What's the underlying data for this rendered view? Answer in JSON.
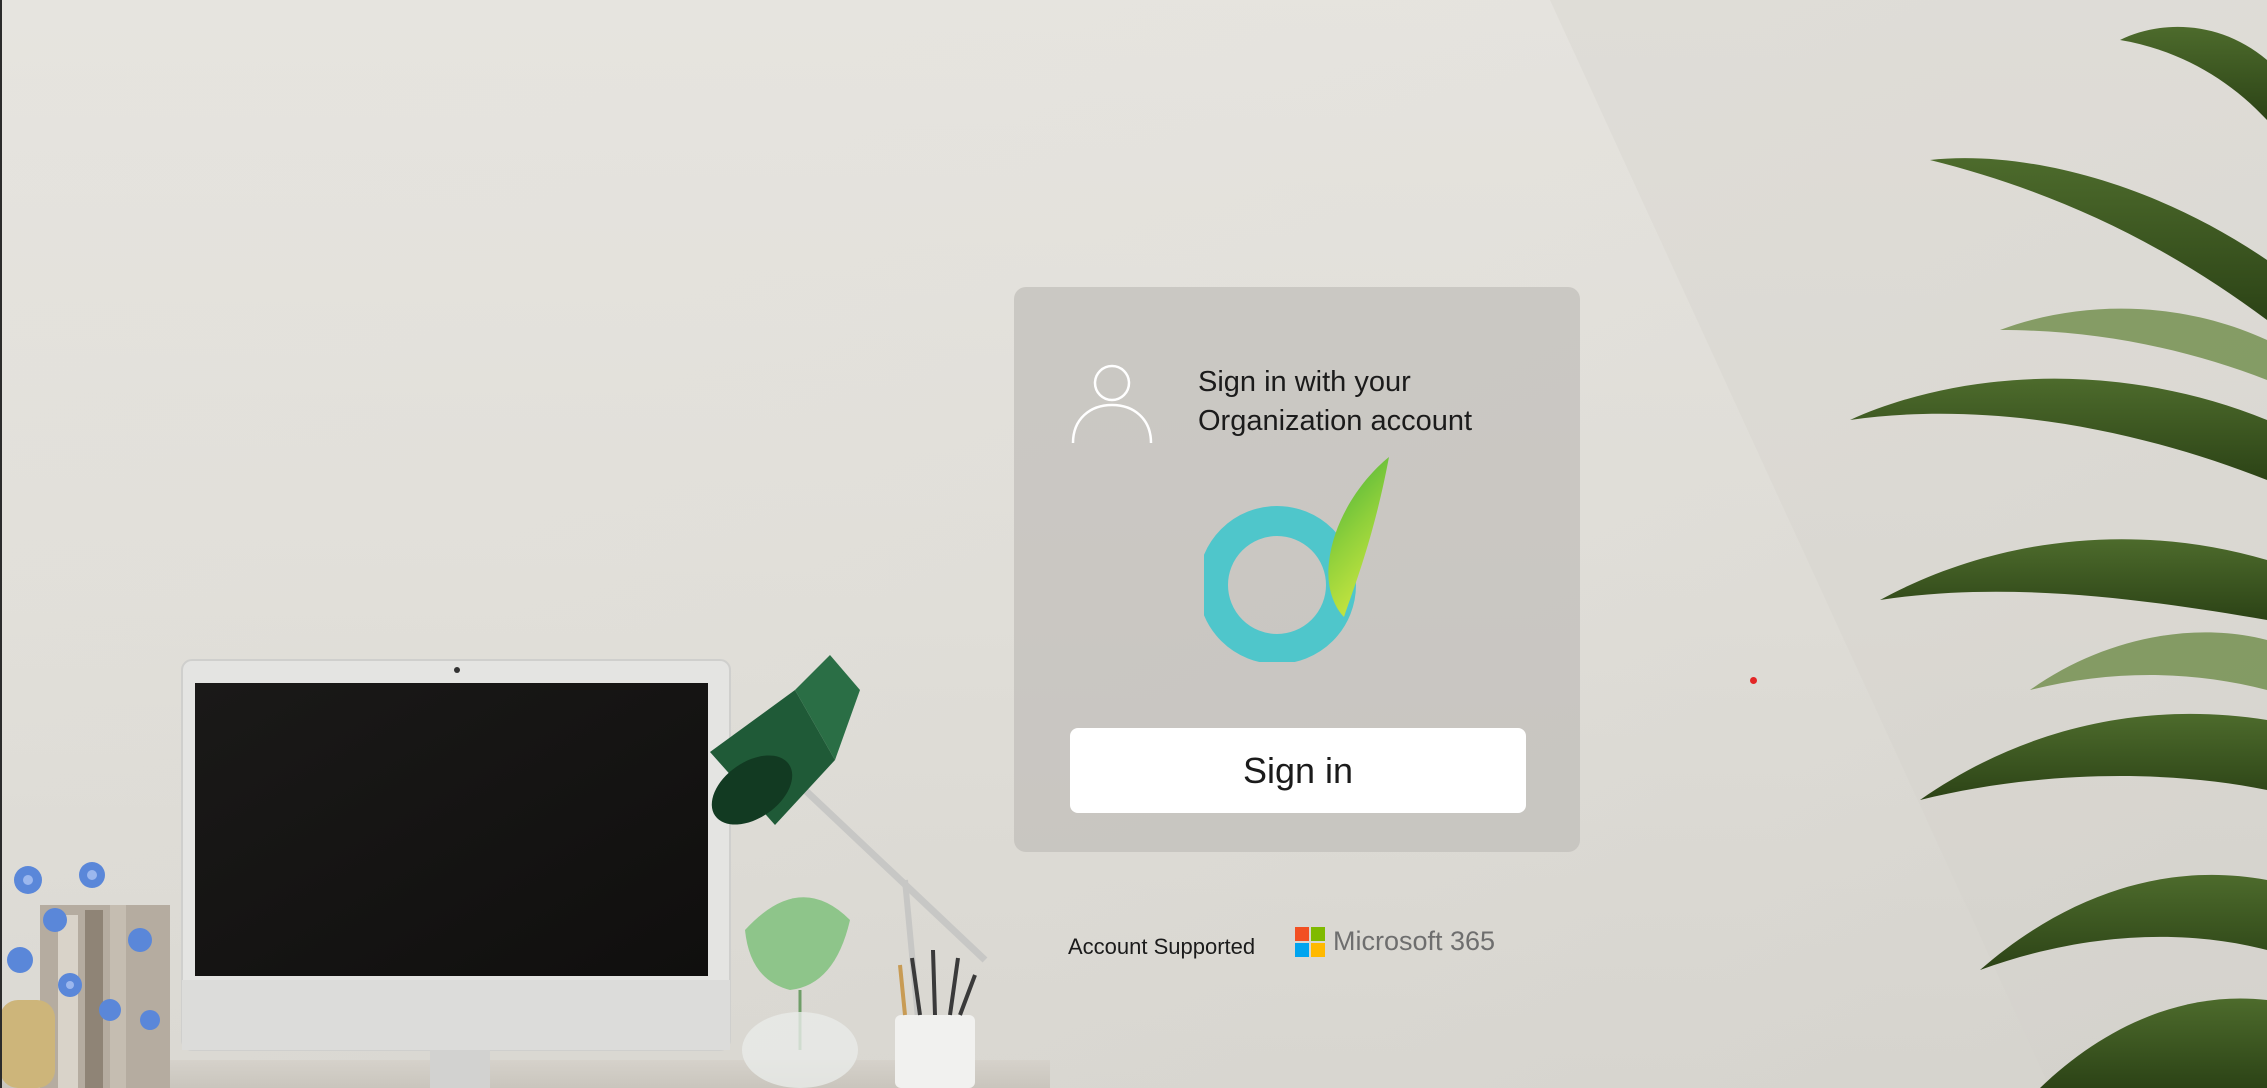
{
  "card": {
    "title": "Sign in with your Organization account",
    "signin_label": "Sign in"
  },
  "footer": {
    "account_supported": "Account Supported",
    "microsoft_label": "Microsoft 365"
  },
  "icons": {
    "user": "user-icon",
    "brand_logo": "brand-logo",
    "microsoft_logo": "microsoft-logo-icon"
  },
  "colors": {
    "brand_ring": "#4fc6cb",
    "brand_leaf_light": "#c8e640",
    "brand_leaf_dark": "#3fae3c",
    "ms_red": "#f25022",
    "ms_green": "#7fba00",
    "ms_blue": "#00a4ef",
    "ms_yellow": "#ffb900",
    "button_bg": "#ffffff"
  }
}
